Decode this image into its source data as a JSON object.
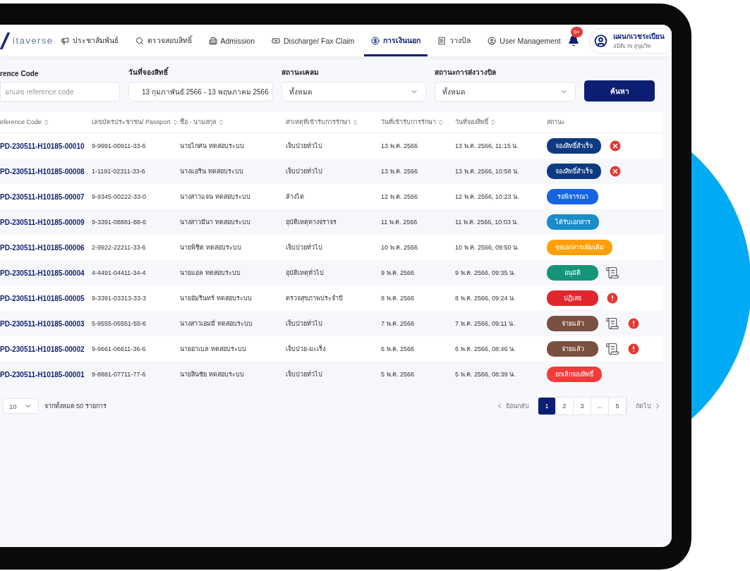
{
  "logo": {
    "text": "itaverse"
  },
  "nav": [
    {
      "label": "ประชาสัมพันธ์",
      "selected": false
    },
    {
      "label": "ตรวจสอบสิทธิ์",
      "selected": false
    },
    {
      "label": "Admission",
      "selected": false
    },
    {
      "label": "Discharge/ Fax Claim",
      "selected": false
    },
    {
      "label": "การเงินนอก",
      "selected": true
    },
    {
      "label": "วางบิล",
      "selected": false
    },
    {
      "label": "User Management",
      "selected": false
    }
  ],
  "notifications": {
    "badge": "9+"
  },
  "user": {
    "name": "แผนกเวชระเบียน",
    "subtitle": "สมิติเวช สุขุมวิท"
  },
  "filters": [
    {
      "kind": "text",
      "label": "rence Code",
      "placeholder": "อกเลข reference code"
    },
    {
      "kind": "date",
      "label": "วันที่จองสิทธิ์",
      "value": "13 กุมภาพันธ์ 2566 - 13 พฤษภาคม 2566"
    },
    {
      "kind": "select",
      "label": "สถานะเคลม",
      "value": "ทั้งหมด"
    },
    {
      "kind": "select",
      "label": "สถานะการส่งวางบิล",
      "value": "ทั้งหมด"
    }
  ],
  "search_button": "ค้นหา",
  "table": {
    "columns": [
      {
        "label": "eference Code",
        "sortable": true
      },
      {
        "label": "เลขบัตรประชาชน/ Passport",
        "sortable": true
      },
      {
        "label": "ชื่อ - นามสกุล",
        "sortable": true
      },
      {
        "label": "สาเหตุที่เข้ารับการรักษา",
        "sortable": true
      },
      {
        "label": "วันที่เข้ารับการรักษา",
        "sortable": true
      },
      {
        "label": "วันที่จองสิทธิ์",
        "sortable": true
      },
      {
        "label": "สถานะ",
        "sortable": false
      }
    ],
    "rows": [
      {
        "ref": "PD-230511-H10185-00010",
        "id": "9-9991-00911-33-6",
        "name": "นายไกศน ทดสอบระบบ",
        "reason": "เจ็บป่วยทั่วไป",
        "admit": "13 พ.ค. 2566",
        "booked": "13 พ.ค. 2566, 11:15 น.",
        "status": {
          "label": "จองสิทธิ์สำเร็จ",
          "color": "#0d3a80"
        },
        "actions": [
          {
            "kind": "cancel"
          }
        ]
      },
      {
        "ref": "PD-230511-H10185-00008",
        "id": "1-1191-02311-33-6",
        "name": "นางแอริน ทดสอบระบบ",
        "reason": "เจ็บป่วยทั่วไป",
        "admit": "13 พ.ค. 2566",
        "booked": "13 พ.ค. 2566, 10:58 น.",
        "status": {
          "label": "จองสิทธิ์สำเร็จ",
          "color": "#0d3a80"
        },
        "actions": [
          {
            "kind": "cancel"
          }
        ]
      },
      {
        "ref": "PD-230511-H10185-00007",
        "id": "9-9345-00222-33-0",
        "name": "นางสาวแจน ทดสอบระบบ",
        "reason": "ล้างไต",
        "admit": "12 พ.ค. 2566",
        "booked": "12 พ.ค. 2566, 10:23 น.",
        "status": {
          "label": "รอพิจารณา",
          "color": "#1565e0"
        },
        "actions": []
      },
      {
        "ref": "PD-230511-H10185-00009",
        "id": "9-3391-08881-88-6",
        "name": "นางสาวมีนา ทดสอบระบบ",
        "reason": "อุบัติเหตุทางจราจร",
        "admit": "11 พ.ค. 2566",
        "booked": "11 พ.ค. 2566, 10:03 น.",
        "status": {
          "label": "ได้รับเอกสาร",
          "color": "#1a8cc7"
        },
        "actions": []
      },
      {
        "ref": "PD-230511-H10185-00006",
        "id": "2-9922-22211-33-6",
        "name": "นายพิชิต ทดสอบระบบ",
        "reason": "เจ็บป่วยทั่วไป",
        "admit": "10 พ.ค. 2566",
        "booked": "10 พ.ค. 2566, 09:50 น.",
        "status": {
          "label": "ขอเอกสารเพิ่มเติม",
          "color": "#ff9f0a"
        },
        "actions": []
      },
      {
        "ref": "PD-230511-H10185-00004",
        "id": "4-4491-04411-34-4",
        "name": "นายแอล ทดสอบระบบ",
        "reason": "อุบัติเหตุทั่วไป",
        "admit": "9 พ.ค. 2566",
        "booked": "9 พ.ค. 2566, 09:35 น.",
        "status": {
          "label": "อนุมัติ",
          "color": "#14957a"
        },
        "actions": [
          {
            "kind": "document"
          }
        ]
      },
      {
        "ref": "PD-230511-H10185-00005",
        "id": "9-3391-03313-33-3",
        "name": "นายอัมรินทร์ ทดสอบระบบ",
        "reason": "ตรวจสุขภาพประจำปี",
        "admit": "8 พ.ค. 2566",
        "booked": "8 พ.ค. 2566, 09:24 น.",
        "status": {
          "label": "ปฏิเสธ",
          "color": "#e0262f"
        },
        "actions": [
          {
            "kind": "alert"
          }
        ]
      },
      {
        "ref": "PD-230511-H10185-00003",
        "id": "5-9555-05551-55-6",
        "name": "นางสาวเอมมี่ ทดสอบระบบ",
        "reason": "เจ็บป่วยทั่วไป",
        "admit": "7 พ.ค. 2566",
        "booked": "7 พ.ค. 2566, 09:11 น.",
        "status": {
          "label": "จ่ายแล้ว",
          "color": "#7a5040"
        },
        "actions": [
          {
            "kind": "document"
          },
          {
            "kind": "alert"
          }
        ]
      },
      {
        "ref": "PD-230511-H10185-00002",
        "id": "9-9661-06611-36-6",
        "name": "นายอาเบล ทดสอบระบบ",
        "reason": "เจ็บป่วย-มะเร็ง",
        "admit": "6 พ.ค. 2566",
        "booked": "6 พ.ค. 2566, 08:46 น.",
        "status": {
          "label": "จ่ายแล้ว",
          "color": "#7a5040"
        },
        "actions": [
          {
            "kind": "document"
          },
          {
            "kind": "alert"
          }
        ]
      },
      {
        "ref": "PD-230511-H10185-00001",
        "id": "9-8881-07711-77-6",
        "name": "นายสินชัย ทดสอบระบบ",
        "reason": "เจ็บป่วยทั่วไป",
        "admit": "5 พ.ค. 2566",
        "booked": "5 พ.ค. 2566, 08:39 น.",
        "status": {
          "label": "ยกเลิกจองสิทธิ์",
          "color": "#f23c3c"
        },
        "actions": []
      }
    ]
  },
  "pagination": {
    "page_size": "10",
    "total": "จากทั้งหมด 50 รายการ",
    "prev": "ย้อนกลับ",
    "next": "ถัดไป",
    "pages": [
      {
        "label": "1",
        "selected": true
      },
      {
        "label": "2",
        "selected": false
      },
      {
        "label": "3",
        "selected": false
      },
      {
        "label": "...",
        "selected": false
      },
      {
        "label": "5",
        "selected": false
      }
    ]
  }
}
